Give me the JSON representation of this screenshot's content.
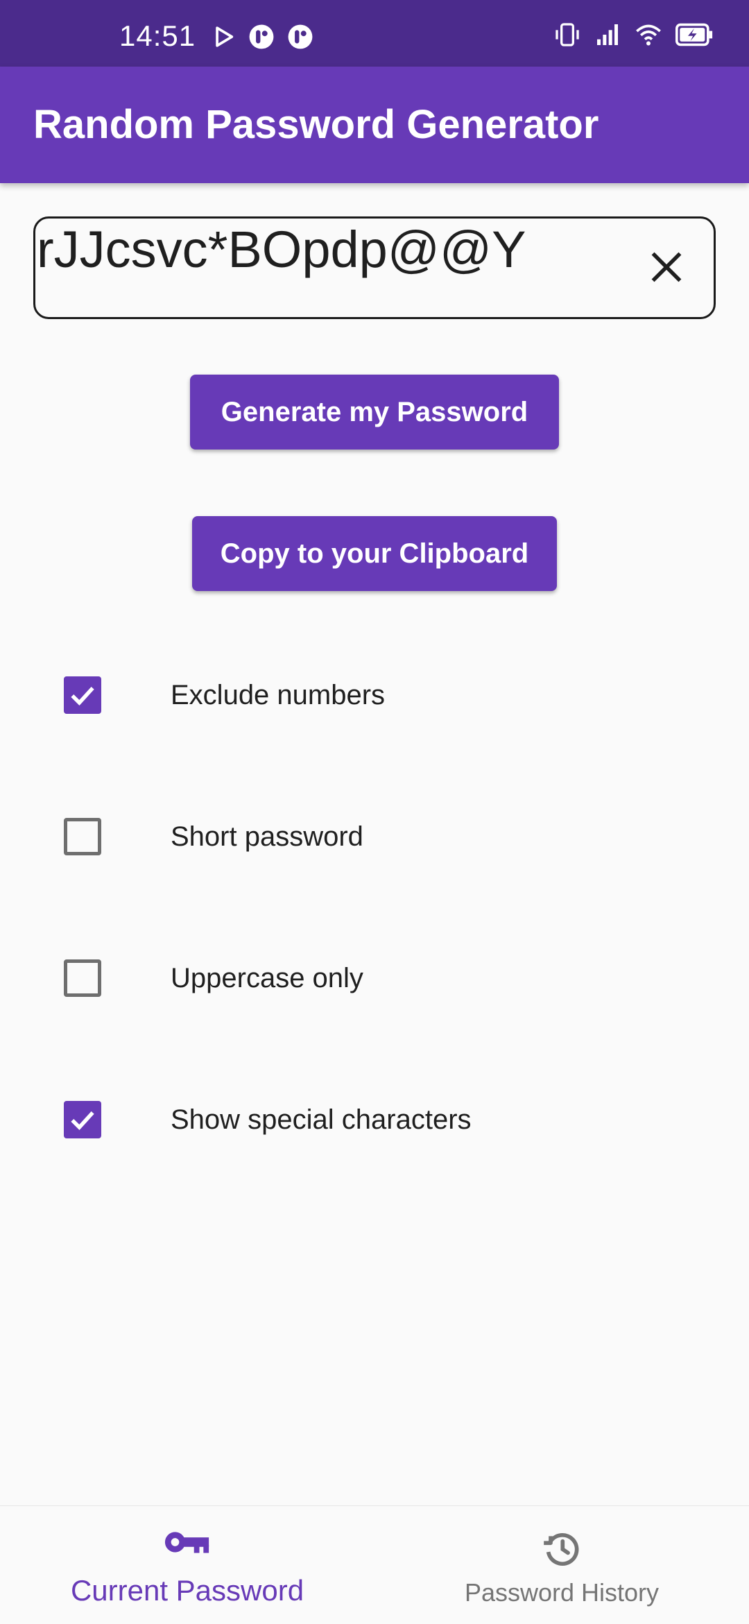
{
  "status_bar": {
    "time": "14:51",
    "left_icons": [
      "play-store-icon",
      "notification-icon",
      "notification-icon"
    ],
    "right_icons": [
      "vibrate-icon",
      "signal-icon",
      "wifi-icon",
      "battery-charging-icon"
    ]
  },
  "app_bar": {
    "title": "Random Password Generator"
  },
  "password_field": {
    "value": "rJJcsvc*BOpdp@@Y",
    "clear_icon": "close-icon"
  },
  "buttons": {
    "generate": "Generate my Password",
    "copy": "Copy to your Clipboard"
  },
  "options": [
    {
      "label": "Exclude numbers",
      "checked": true
    },
    {
      "label": "Short password",
      "checked": false
    },
    {
      "label": "Uppercase only",
      "checked": false
    },
    {
      "label": "Show special characters",
      "checked": true
    }
  ],
  "bottom_nav": {
    "items": [
      {
        "label": "Current Password",
        "icon": "key-icon",
        "active": true
      },
      {
        "label": "Password History",
        "icon": "history-icon",
        "active": false
      }
    ]
  },
  "colors": {
    "primary": "#673ab7",
    "status_bar": "#4b2b8c",
    "inactive": "#757575"
  }
}
